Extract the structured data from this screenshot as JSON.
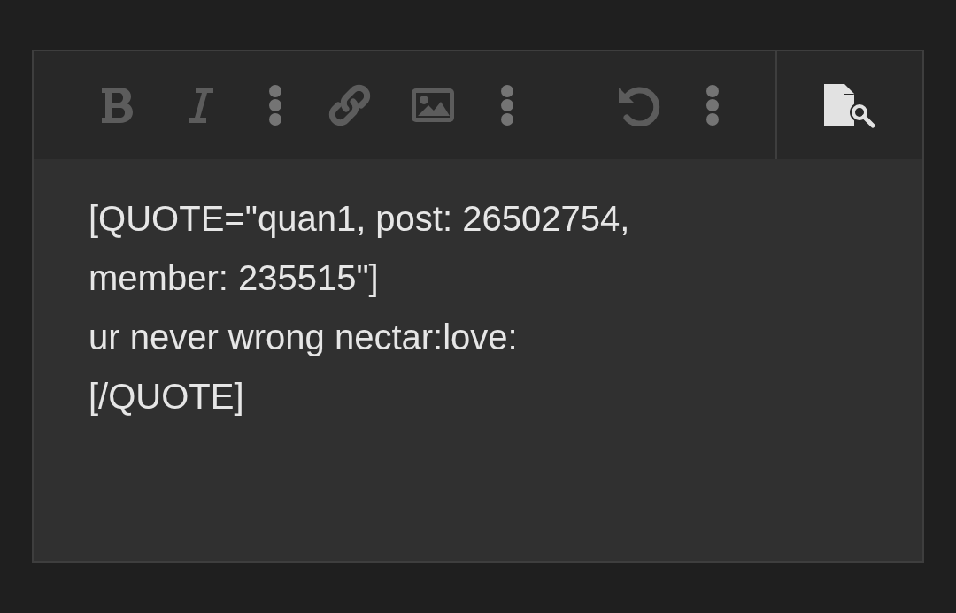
{
  "toolbar": {
    "buttons": [
      {
        "kind": "bold"
      },
      {
        "kind": "italic"
      },
      {
        "kind": "more"
      },
      {
        "kind": "link"
      },
      {
        "kind": "image"
      },
      {
        "kind": "more"
      },
      {
        "kind": "gap"
      },
      {
        "kind": "undo"
      },
      {
        "kind": "more"
      }
    ],
    "side_buttons": [
      {
        "kind": "preview"
      }
    ]
  },
  "editor": {
    "value": "[QUOTE=\"quan1, post: 26502754, member: 235515\"]\nur never wrong nectar:love:\n[/QUOTE]\n"
  }
}
